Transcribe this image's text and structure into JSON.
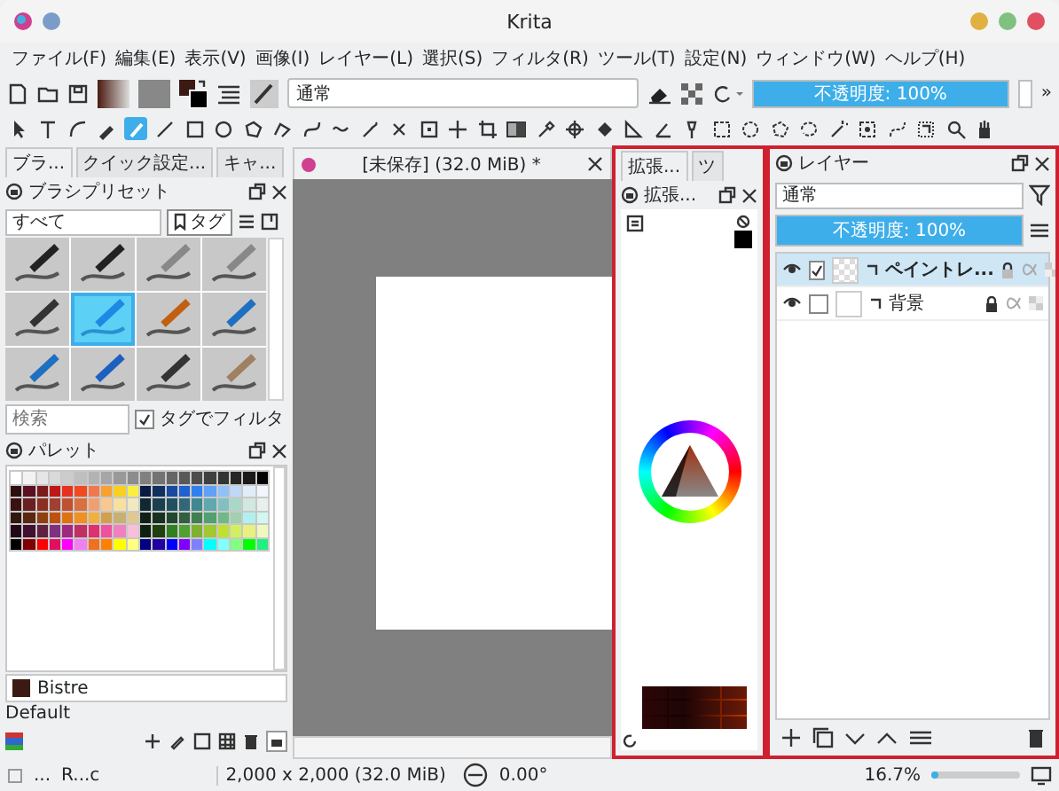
{
  "window": {
    "title": "Krita"
  },
  "menu": [
    "ファイル(F)",
    "編集(E)",
    "表示(V)",
    "画像(I)",
    "レイヤー(L)",
    "選択(S)",
    "フィルタ(R)",
    "ツール(T)",
    "設定(N)",
    "ウィンドウ(W)",
    "ヘルプ(H)"
  ],
  "toolbar": {
    "blend_mode": "通常",
    "opacity": {
      "label": "不透明度: 100%",
      "level": 1.0
    },
    "overflow": "»"
  },
  "tools": [
    {
      "selected": false
    },
    {
      "selected": false
    },
    {
      "selected": false
    },
    {
      "selected": false
    },
    {
      "selected": true
    },
    {
      "selected": false
    },
    {
      "selected": false
    },
    {
      "selected": false
    },
    {
      "selected": false
    },
    {
      "selected": false
    },
    {
      "selected": false
    },
    {
      "selected": false
    },
    {
      "selected": false
    },
    {
      "selected": false
    },
    {
      "selected": false
    },
    {
      "selected": false
    },
    {
      "selected": false
    },
    {
      "selected": false
    },
    {
      "selected": false
    },
    {
      "selected": false
    },
    {
      "selected": false
    },
    {
      "selected": false
    },
    {
      "selected": false
    },
    {
      "selected": false
    },
    {
      "selected": false
    },
    {
      "selected": false
    },
    {
      "selected": false
    },
    {
      "selected": false
    },
    {
      "selected": false
    },
    {
      "selected": false
    },
    {
      "selected": false
    },
    {
      "selected": false
    },
    {
      "selected": false
    },
    {
      "selected": false
    }
  ],
  "left_dock": {
    "tabs": [
      {
        "label": "ブラ...",
        "selected": true
      },
      {
        "label": "クイック設定...",
        "selected": false
      },
      {
        "label": "キャ...",
        "selected": false
      }
    ],
    "brush_presets": {
      "title": "ブラシプリセット",
      "filter": "すべて",
      "tag_button": "タグ",
      "presets": [
        {
          "selected": false
        },
        {
          "selected": false
        },
        {
          "selected": false
        },
        {
          "selected": false
        },
        {
          "selected": false
        },
        {
          "selected": true
        },
        {
          "selected": false
        },
        {
          "selected": false
        },
        {
          "selected": false
        },
        {
          "selected": false
        },
        {
          "selected": false
        },
        {
          "selected": false
        }
      ],
      "search": {
        "placeholder": "検索"
      },
      "filter_by_tag": {
        "label": "タグでフィルタ",
        "checked": true
      }
    },
    "palette": {
      "title": "パレット",
      "swatch_rows": [
        {
          "swatches": [
            {
              "color": "#ffffff"
            },
            {
              "color": "#f2f2f2"
            },
            {
              "color": "#e6e6e6"
            },
            {
              "color": "#d9d9d9"
            },
            {
              "color": "#cccccc"
            },
            {
              "color": "#bfbfbf"
            },
            {
              "color": "#b3b3b3"
            },
            {
              "color": "#a6a6a6"
            },
            {
              "color": "#999999"
            },
            {
              "color": "#8c8c8c"
            },
            {
              "color": "#808080"
            },
            {
              "color": "#737373"
            },
            {
              "color": "#666666"
            },
            {
              "color": "#595959"
            },
            {
              "color": "#4d4d4d"
            },
            {
              "color": "#404040"
            },
            {
              "color": "#333333"
            },
            {
              "color": "#262626"
            },
            {
              "color": "#1a1a1a"
            },
            {
              "color": "#000000"
            }
          ]
        },
        {
          "swatches": [
            {
              "color": "#2b0f0f"
            },
            {
              "color": "#5a1020"
            },
            {
              "color": "#7a1a1a"
            },
            {
              "color": "#c01818"
            },
            {
              "color": "#e83020"
            },
            {
              "color": "#f04a20"
            },
            {
              "color": "#f07850"
            },
            {
              "color": "#f8a030"
            },
            {
              "color": "#f8d020"
            },
            {
              "color": "#f8f040"
            },
            {
              "color": "#0a1a40"
            },
            {
              "color": "#103060"
            },
            {
              "color": "#1a4aa0"
            },
            {
              "color": "#2060d0"
            },
            {
              "color": "#3080f0"
            },
            {
              "color": "#60a0f8"
            },
            {
              "color": "#90c0f8"
            },
            {
              "color": "#c0d8f8"
            },
            {
              "color": "#e0ecf8"
            },
            {
              "color": "#f0f6fc"
            }
          ]
        },
        {
          "swatches": [
            {
              "color": "#3a1010"
            },
            {
              "color": "#6a2020"
            },
            {
              "color": "#8a3020"
            },
            {
              "color": "#a04030"
            },
            {
              "color": "#c05030"
            },
            {
              "color": "#d87040"
            },
            {
              "color": "#f0a070"
            },
            {
              "color": "#f8c890"
            },
            {
              "color": "#f8e0a0"
            },
            {
              "color": "#f0e8c0"
            },
            {
              "color": "#102830"
            },
            {
              "color": "#1a4050"
            },
            {
              "color": "#205060"
            },
            {
              "color": "#306878"
            },
            {
              "color": "#408890"
            },
            {
              "color": "#60a8b0"
            },
            {
              "color": "#80c0c0"
            },
            {
              "color": "#a8d8c8"
            },
            {
              "color": "#d0e8e0"
            },
            {
              "color": "#e8f0ec"
            }
          ]
        },
        {
          "swatches": [
            {
              "color": "#301810"
            },
            {
              "color": "#5a2810"
            },
            {
              "color": "#904010"
            },
            {
              "color": "#c05010"
            },
            {
              "color": "#e07010"
            },
            {
              "color": "#f09020"
            },
            {
              "color": "#f0b040"
            },
            {
              "color": "#d0a050"
            },
            {
              "color": "#c8b070"
            },
            {
              "color": "#e0c890"
            },
            {
              "color": "#102018"
            },
            {
              "color": "#183020"
            },
            {
              "color": "#204830"
            },
            {
              "color": "#306040"
            },
            {
              "color": "#408050"
            },
            {
              "color": "#50a070"
            },
            {
              "color": "#70b888"
            },
            {
              "color": "#a0d0b0"
            },
            {
              "color": "#b0f0f0"
            },
            {
              "color": "#d0f8f0"
            }
          ]
        },
        {
          "swatches": [
            {
              "color": "#200818"
            },
            {
              "color": "#401030"
            },
            {
              "color": "#602040"
            },
            {
              "color": "#803080"
            },
            {
              "color": "#a02880"
            },
            {
              "color": "#c03060"
            },
            {
              "color": "#e03070"
            },
            {
              "color": "#f050a0"
            },
            {
              "color": "#f080c0"
            },
            {
              "color": "#f8c0d8"
            },
            {
              "color": "#102010"
            },
            {
              "color": "#204010"
            },
            {
              "color": "#308020"
            },
            {
              "color": "#50a030"
            },
            {
              "color": "#80b030"
            },
            {
              "color": "#a0c830"
            },
            {
              "color": "#c0e030"
            },
            {
              "color": "#d0f060"
            },
            {
              "color": "#e8f080"
            },
            {
              "color": "#f0f8c0"
            }
          ]
        },
        {
          "swatches": [
            {
              "color": "#000000"
            },
            {
              "color": "#800000"
            },
            {
              "color": "#ff0000"
            },
            {
              "color": "#e01060"
            },
            {
              "color": "#ff00ff"
            },
            {
              "color": "#f080f0"
            },
            {
              "color": "#f07020"
            },
            {
              "color": "#ff8000"
            },
            {
              "color": "#ffff00"
            },
            {
              "color": "#ffff80"
            },
            {
              "color": "#000080"
            },
            {
              "color": "#2000a0"
            },
            {
              "color": "#0000ff"
            },
            {
              "color": "#8000ff"
            },
            {
              "color": "#8080ff"
            },
            {
              "color": "#00ffff"
            },
            {
              "color": "#80ffff"
            },
            {
              "color": "#80ff80"
            },
            {
              "color": "#00ff00"
            },
            {
              "color": "#20f080"
            }
          ]
        }
      ],
      "current_color": {
        "name": "Bistre",
        "color": "#3a1a12"
      },
      "palette_name": "Default"
    }
  },
  "canvas": {
    "tab_title": "[未保存] (32.0 MiB) *"
  },
  "color_dock": {
    "tabs": [
      {
        "label": "拡張...",
        "selected": true
      },
      {
        "label": "ツ",
        "selected": false
      }
    ],
    "title": "拡張..."
  },
  "layers_dock": {
    "title": "レイヤー",
    "blend_mode": "通常",
    "opacity": {
      "label": "不透明度: 100%",
      "level": 1.0
    },
    "layers": [
      {
        "name": "ペイントレ...",
        "selected": true,
        "checked": true,
        "locked": false,
        "transparent": true
      },
      {
        "name": "背景",
        "selected": false,
        "checked": false,
        "locked": true,
        "transparent": false
      }
    ]
  },
  "status_bar": {
    "items": [
      "...",
      "R...c"
    ],
    "size": "2,000 x 2,000 (32.0 MiB)",
    "rotation": "0.00°",
    "zoom": "16.7%",
    "zoom_slider": {
      "level": 0.08
    }
  }
}
